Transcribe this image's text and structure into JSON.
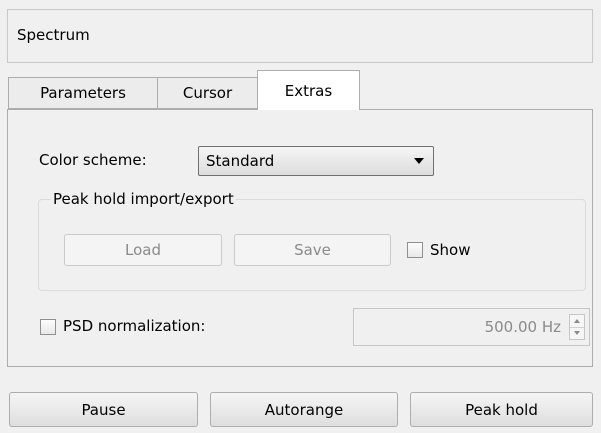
{
  "title": "Spectrum",
  "tabs": [
    {
      "label": "Parameters",
      "active": false
    },
    {
      "label": "Cursor",
      "active": false
    },
    {
      "label": "Extras",
      "active": true
    }
  ],
  "extras": {
    "color_scheme_label": "Color scheme:",
    "color_scheme_value": "Standard",
    "peak_hold_group_title": "Peak hold import/export",
    "load_label": "Load",
    "save_label": "Save",
    "show_label": "Show",
    "show_checked": false,
    "psd_label": "PSD normalization:",
    "psd_checked": false,
    "psd_value": "500.00 Hz"
  },
  "actions": {
    "pause_label": "Pause",
    "autorange_label": "Autorange",
    "peak_hold_label": "Peak hold"
  }
}
